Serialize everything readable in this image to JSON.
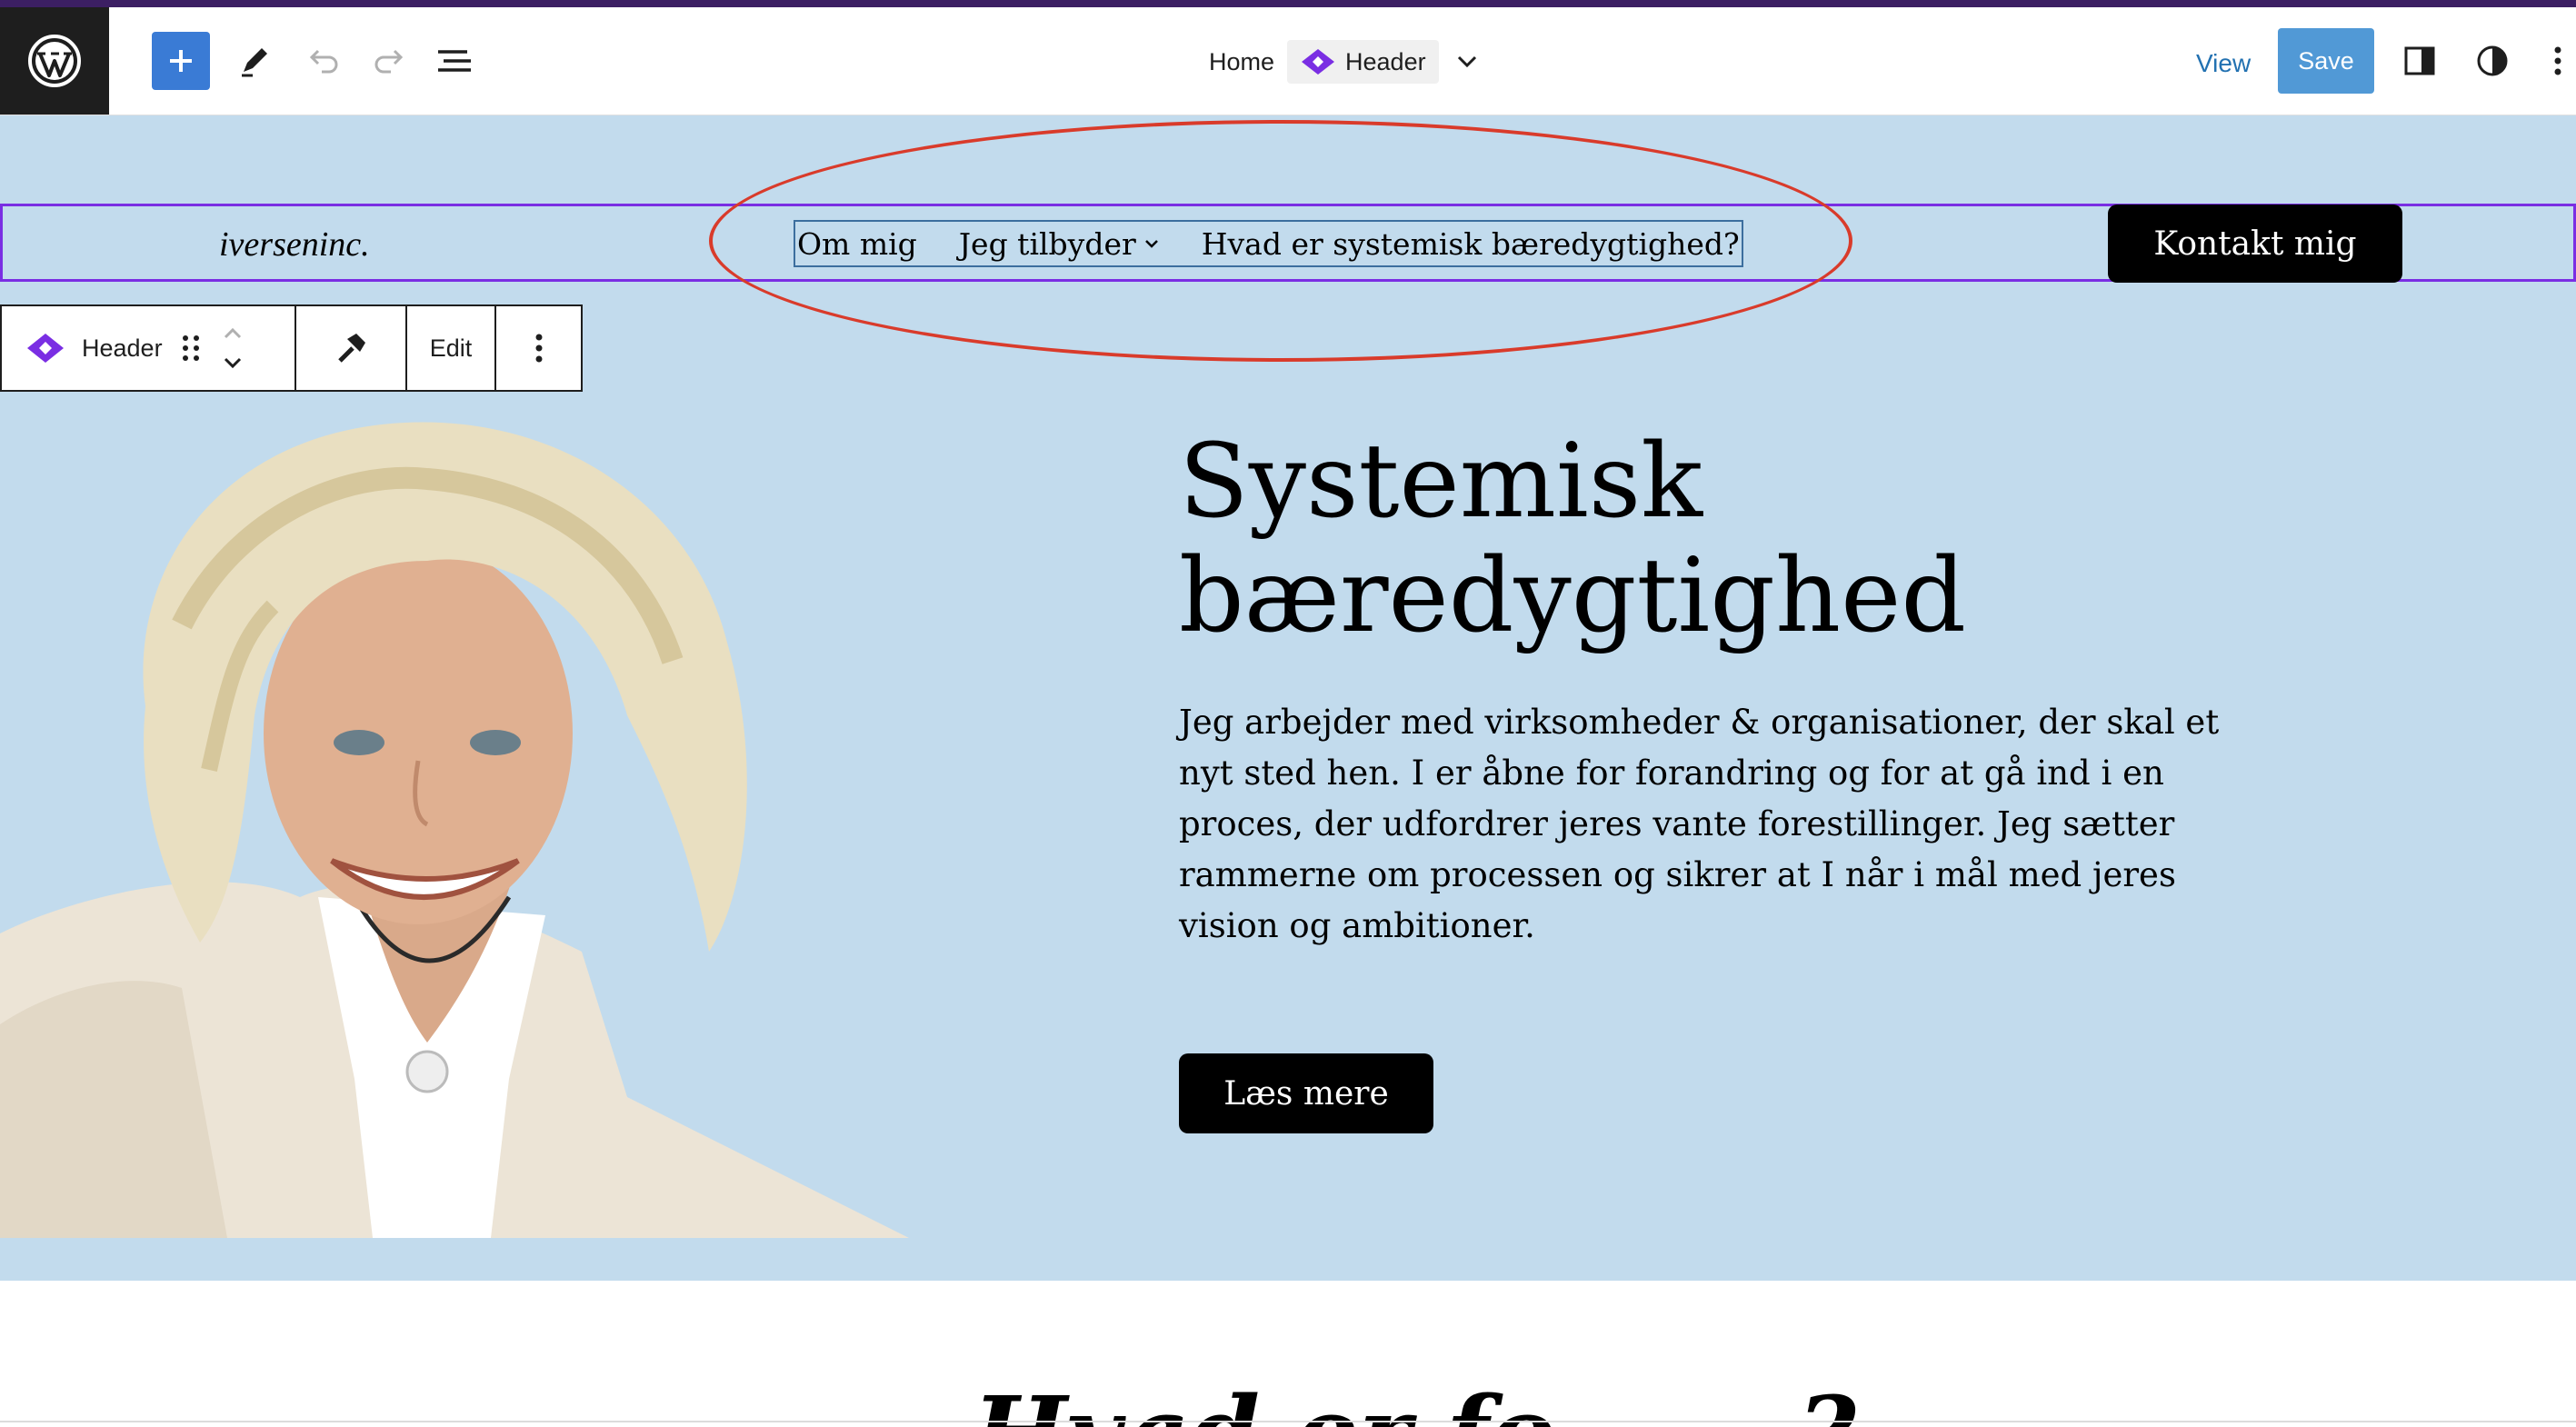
{
  "editor": {
    "breadcrumb": {
      "home": "Home",
      "template": "Header"
    },
    "view_label": "View",
    "save_label": "Save",
    "icons": [
      "wordpress-icon",
      "plus-icon",
      "pencil-icon",
      "undo-icon",
      "redo-icon",
      "list-view-icon",
      "chevron-down-icon",
      "sidebar-icon",
      "contrast-icon",
      "more-vertical-icon"
    ]
  },
  "site": {
    "title": "iverseninc.",
    "nav": [
      {
        "label": "Om mig",
        "has_submenu": false
      },
      {
        "label": "Jeg tilbyder",
        "has_submenu": true
      },
      {
        "label": "Hvad er systemisk bæredygtighed?",
        "has_submenu": false
      }
    ],
    "contact_label": "Kontakt mig"
  },
  "block_toolbar": {
    "label": "Header",
    "edit_label": "Edit"
  },
  "hero": {
    "title_line1": "Systemisk",
    "title_line2": "bæredygtighed",
    "text": "Jeg arbejder med virksomheder & organisationer, der skal et nyt sted hen. I er åbne for forandring og for at gå ind i en proces, der udfordrer jeres vante forestillinger. Jeg sætter rammerne om processen og sikrer at I når i mål med jeres vision og ambitioner.",
    "button_label": "Læs mere"
  },
  "next_section": {
    "heading": "Hvad er fo... ...?"
  },
  "colors": {
    "accent": "#3a7bd5",
    "selection": "#7a2ee3",
    "annotation": "#d93b2b",
    "hero_bg": "#c2dbed"
  }
}
